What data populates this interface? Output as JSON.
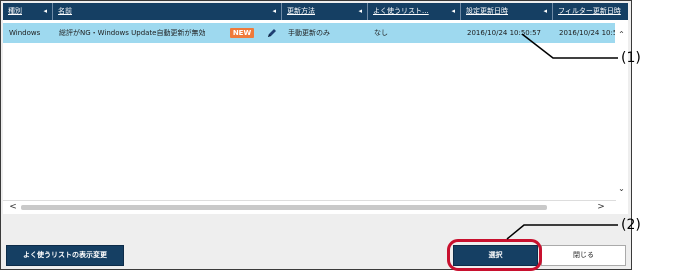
{
  "table": {
    "columns": [
      {
        "label": "種別"
      },
      {
        "label": "名前"
      },
      {
        "label": "更新方法"
      },
      {
        "label": "よく使うリスト..."
      },
      {
        "label": "設定更新日時"
      },
      {
        "label": "フィルター更新日時"
      }
    ],
    "sort_indicator": "◂",
    "rows": [
      {
        "type": "Windows",
        "name": "総評がNG・Windows Update自動更新が無効",
        "badge": "NEW",
        "update_method": "手動更新のみ",
        "favorite": "なし",
        "settings_updated": "2016/10/24 10:50:57",
        "filter_updated": "2016/10/24 10:5"
      }
    ]
  },
  "scrollbars": {
    "up_arrow": "⌃",
    "down_arrow": "⌄",
    "left_arrow": "<",
    "right_arrow": ">"
  },
  "footer": {
    "change_list_button": "よく使うリストの表示変更",
    "select_button": "選択",
    "close_button": "閉じる"
  },
  "callouts": {
    "one": "(1)",
    "two": "(2)"
  },
  "colors": {
    "header_bg": "#153f63",
    "selected_row_bg": "#9ed9ef",
    "badge_bg": "#ef7a3a",
    "highlight_ring": "#c8102e"
  }
}
